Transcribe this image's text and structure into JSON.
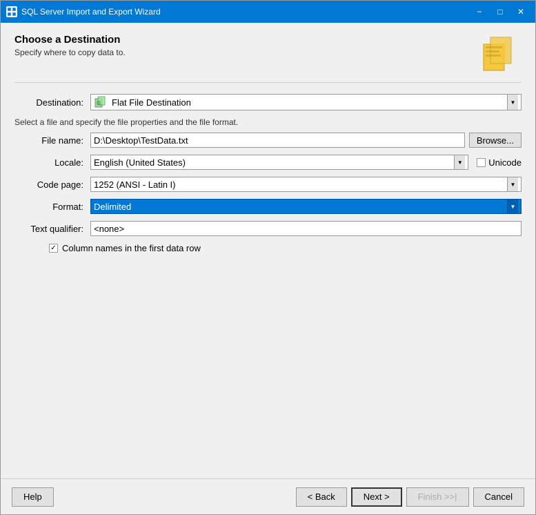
{
  "window": {
    "title": "SQL Server Import and Export Wizard",
    "controls": {
      "minimize": "−",
      "maximize": "□",
      "close": "✕"
    }
  },
  "header": {
    "title": "Choose a Destination",
    "subtitle": "Specify where to copy data to."
  },
  "form": {
    "destination_label": "Destination:",
    "destination_value": "Flat File Destination",
    "file_description": "Select a file and specify the file properties and the file format.",
    "file_name_label": "File name:",
    "file_name_value": "D:\\Desktop\\TestData.txt",
    "browse_label": "Browse...",
    "locale_label": "Locale:",
    "locale_value": "English (United States)",
    "unicode_label": "Unicode",
    "code_page_label": "Code page:",
    "code_page_value": "1252  (ANSI - Latin I)",
    "format_label": "Format:",
    "format_value": "Delimited",
    "text_qualifier_label": "Text qualifier:",
    "text_qualifier_value": "<none>",
    "column_names_label": "Column names in the first data row",
    "column_names_checked": true
  },
  "footer": {
    "help_label": "Help",
    "back_label": "< Back",
    "next_label": "Next >",
    "finish_label": "Finish >>|",
    "cancel_label": "Cancel"
  }
}
